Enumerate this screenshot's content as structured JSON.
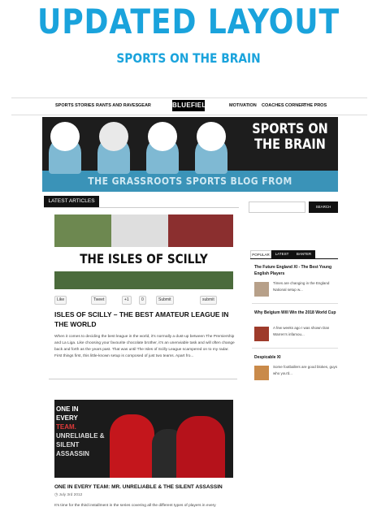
{
  "hero": {
    "title": "UPDATED LAYOUT",
    "subtitle": "SPORTS ON THE BRAIN"
  },
  "nav": {
    "items": [
      "SPORTS STORIES",
      "RANTS AND RAVES",
      "GEAR",
      "MOTIVATION",
      "COACHES CORNER",
      "THE PROS"
    ],
    "logo": "BLUEFIELDS"
  },
  "banner": {
    "title": "SPORTS ON THE BRAIN",
    "tagline": "THE GRASSROOTS SPORTS BLOG FROM BLUEFIELDS.COM"
  },
  "latest_label": "LATEST ARTICLES",
  "post1": {
    "image_title": "THE ISLES OF SCILLY",
    "share": [
      "Like",
      "Tweet",
      "+1",
      "0",
      "Submit",
      "submit"
    ],
    "title": "ISLES OF SCILLY – THE BEST AMATEUR LEAGUE IN THE WORLD",
    "excerpt": "When it comes to deciding the best league in the world, it's normally a dust-up between The Premiership and La Liga. Like choosing your favourite chocolate brother, it's an unenviable task and will often change back and forth as the years past. That was until The Isles of Scilly League scampered on to my radar. First things first, this little-known setup is composed of just two teams. Apart fro..."
  },
  "post2": {
    "image_text": [
      "ONE IN",
      "EVERY",
      "TEAM.",
      "UNRELIABLE &",
      "SILENT ASSASSIN"
    ],
    "title": "ONE IN EVERY TEAM: MR. UNRELIABLE & THE SILENT ASSASSIN",
    "date": "July 3rd 2012",
    "excerpt": "It's time for the third installment in the series covering all the different types of players in every"
  },
  "search": {
    "placeholder": "",
    "button": "SEARCH"
  },
  "sidebar": {
    "tabs": [
      "POPULAR",
      "LATEST",
      "BANTER"
    ],
    "items": [
      {
        "title": "The Future England XI - The Best Young English Players",
        "excerpt": "Times are changing in the England National setup w..."
      },
      {
        "title": "Why Belgium Will Win the 2018 World Cup",
        "excerpt": "A few weeks ago I was shown Dan Warren's infamou..."
      },
      {
        "title": "Despicable XI",
        "excerpt": "Some footballers are good blokes, guys who you'd..."
      }
    ]
  },
  "colors": {
    "accent": "#1aa3dc",
    "dark": "#111111",
    "banner_blue": "#3a93b8"
  }
}
